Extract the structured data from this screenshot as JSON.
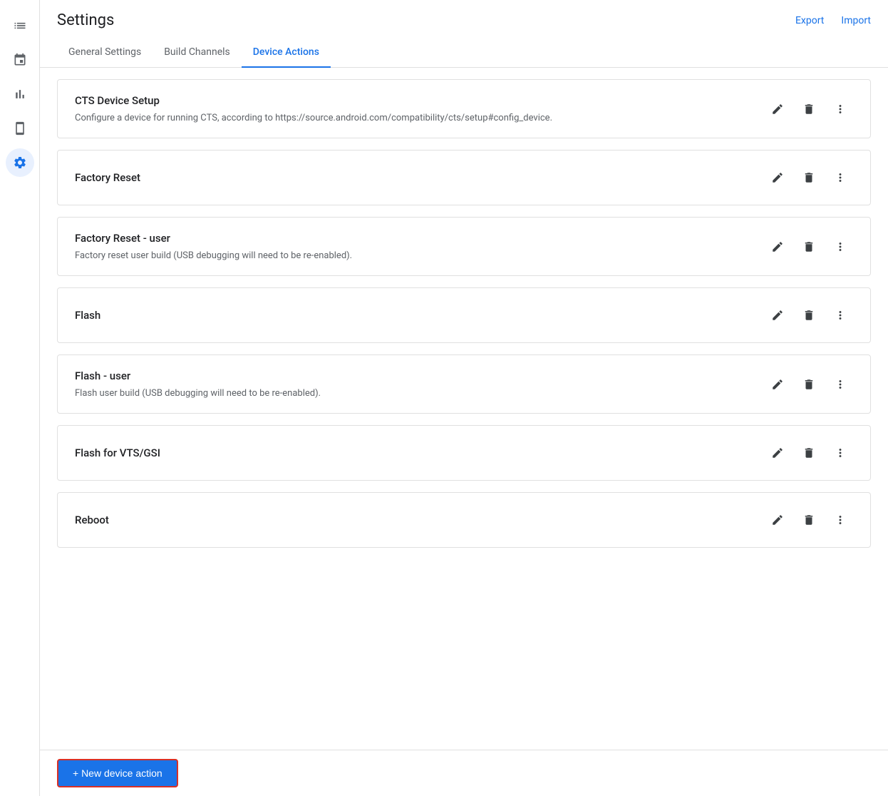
{
  "header": {
    "title": "Settings",
    "export_label": "Export",
    "import_label": "Import"
  },
  "tabs": [
    {
      "id": "general",
      "label": "General Settings",
      "active": false
    },
    {
      "id": "build-channels",
      "label": "Build Channels",
      "active": false
    },
    {
      "id": "device-actions",
      "label": "Device Actions",
      "active": true
    }
  ],
  "sidebar": {
    "items": [
      {
        "id": "list",
        "icon": "≡",
        "label": "List",
        "active": false
      },
      {
        "id": "calendar",
        "icon": "▦",
        "label": "Calendar",
        "active": false
      },
      {
        "id": "chart",
        "icon": "▮",
        "label": "Chart",
        "active": false
      },
      {
        "id": "phone",
        "icon": "☐",
        "label": "Phone",
        "active": false
      },
      {
        "id": "settings",
        "icon": "⚙",
        "label": "Settings",
        "active": true
      }
    ]
  },
  "actions": [
    {
      "id": "cts-device-setup",
      "name": "CTS Device Setup",
      "description": "Configure a device for running CTS, according to https://source.android.com/compatibility/cts/setup#config_device."
    },
    {
      "id": "factory-reset",
      "name": "Factory Reset",
      "description": ""
    },
    {
      "id": "factory-reset-user",
      "name": "Factory Reset - user",
      "description": "Factory reset user build (USB debugging will need to be re-enabled)."
    },
    {
      "id": "flash",
      "name": "Flash",
      "description": ""
    },
    {
      "id": "flash-user",
      "name": "Flash - user",
      "description": "Flash user build (USB debugging will need to be re-enabled)."
    },
    {
      "id": "flash-vts-gsi",
      "name": "Flash for VTS/GSI",
      "description": ""
    },
    {
      "id": "reboot",
      "name": "Reboot",
      "description": ""
    }
  ],
  "bottom_bar": {
    "new_action_label": "+ New device action"
  }
}
